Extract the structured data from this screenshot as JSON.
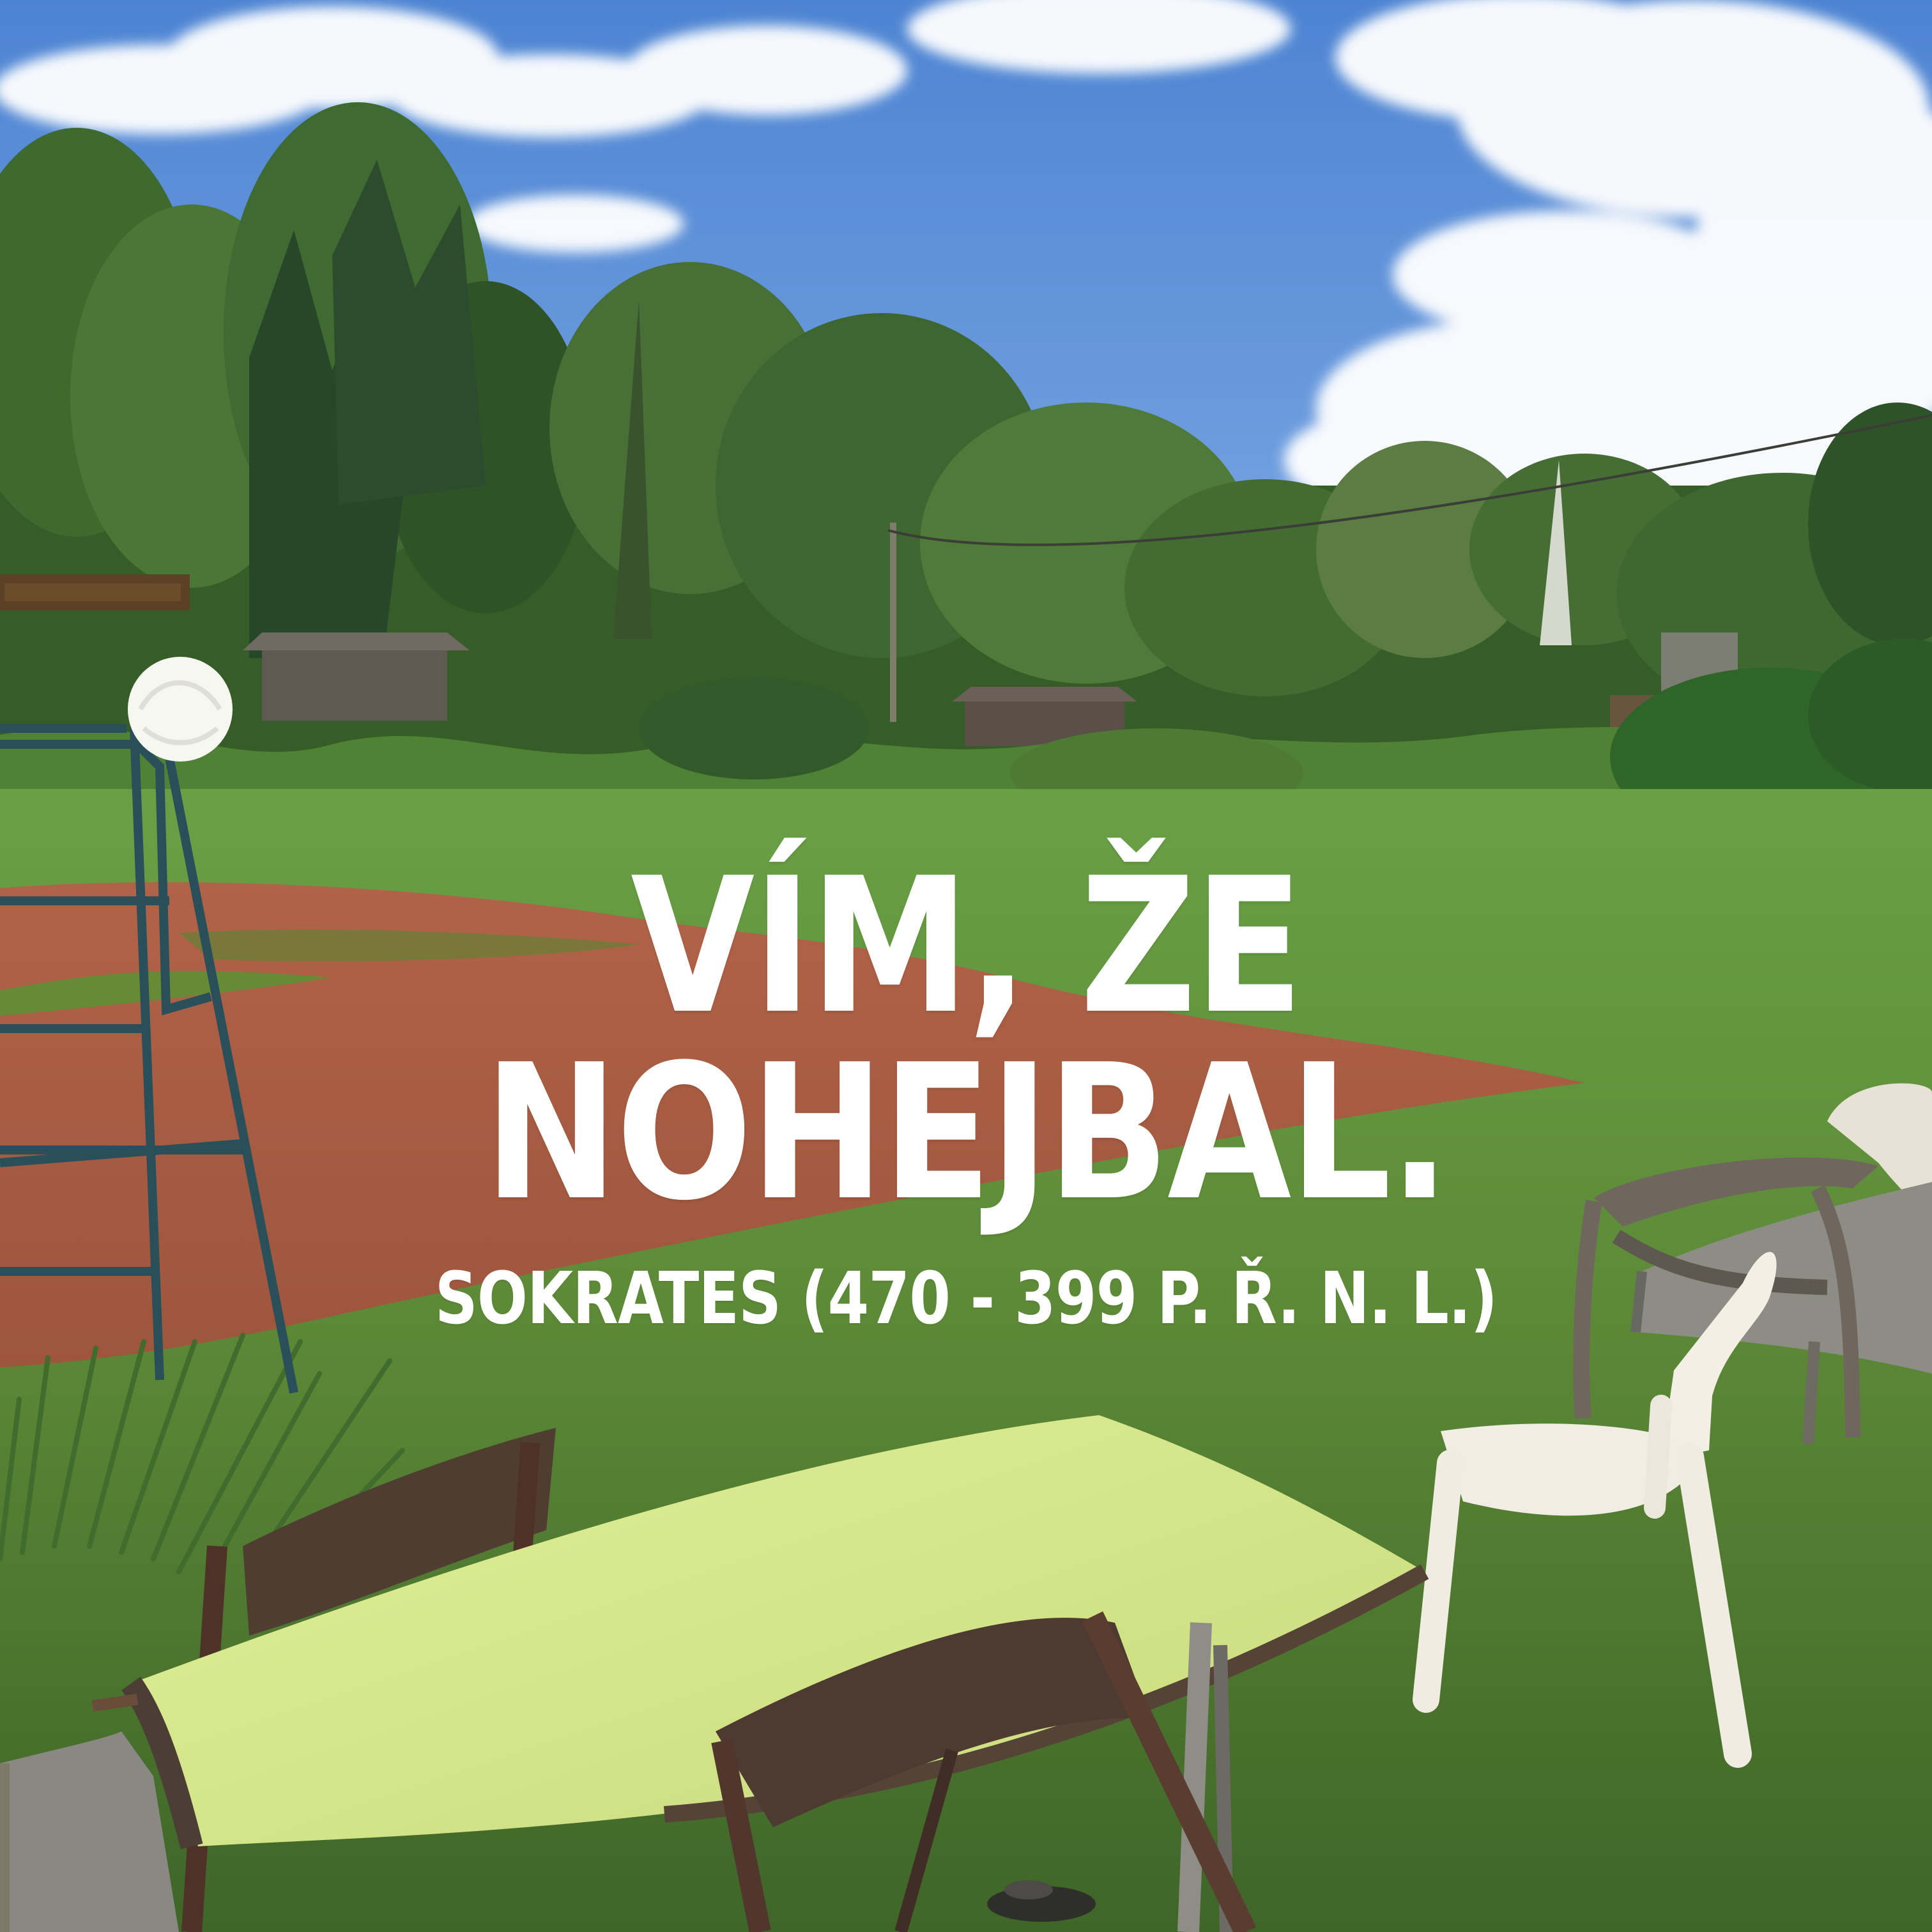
{
  "overlay": {
    "quote": "VÍM, ŽE NOHEJBAL.",
    "author": "SOKRATES (470 - 399 P. Ř. N. L.)"
  },
  "colors": {
    "sky": "#5b8fd5",
    "cloud": "#ffffff",
    "grass": "#5e8d36",
    "court": "#a75a3f",
    "table_top": "#d8ea8a",
    "plastic_chair": "#f5f0e6",
    "text": "#ffffff"
  }
}
